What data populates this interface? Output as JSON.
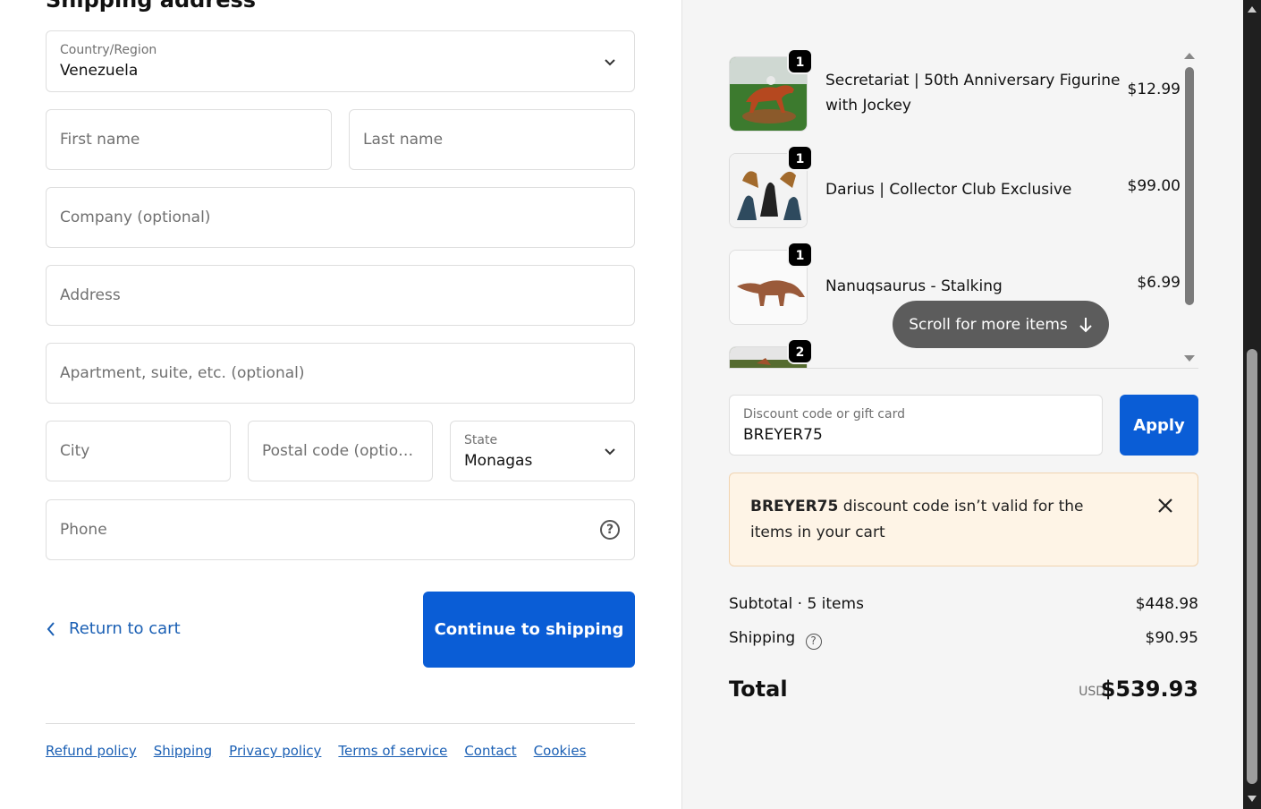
{
  "form": {
    "section_title": "Shipping address",
    "country": {
      "label": "Country/Region",
      "value": "Venezuela"
    },
    "first_name": {
      "placeholder": "First name"
    },
    "last_name": {
      "placeholder": "Last name"
    },
    "company": {
      "placeholder": "Company (optional)"
    },
    "address": {
      "placeholder": "Address"
    },
    "apartment": {
      "placeholder": "Apartment, suite, etc. (optional)"
    },
    "city": {
      "placeholder": "City"
    },
    "postal": {
      "placeholder": "Postal code (option..."
    },
    "state": {
      "label": "State",
      "value": "Monagas"
    },
    "phone": {
      "placeholder": "Phone",
      "help_icon": "?"
    },
    "return_label": "Return to cart",
    "continue_label": "Continue to shipping"
  },
  "footer": {
    "links": [
      "Refund policy",
      "Shipping",
      "Privacy policy",
      "Terms of service",
      "Contact",
      "Cookies"
    ]
  },
  "cart": {
    "items": [
      {
        "qty": "1",
        "name": "Secretariat | 50th Anniversary Figurine with Jockey",
        "price": "$12.99"
      },
      {
        "qty": "1",
        "name": "Darius | Collector Club Exclusive",
        "price": "$99.00"
      },
      {
        "qty": "1",
        "name": "Nanuqsaurus - Stalking",
        "price": "$6.99"
      },
      {
        "qty": "2",
        "name": "",
        "price": ""
      }
    ],
    "scroll_hint": "Scroll for more items"
  },
  "discount": {
    "label": "Discount code or gift card",
    "value": "BREYER75",
    "apply_label": "Apply",
    "error_code": "BREYER75",
    "error_message": " discount code isn’t valid for the items in your cart"
  },
  "summary": {
    "subtotal_label": "Subtotal · 5 items",
    "subtotal_value": "$448.98",
    "shipping_label": "Shipping",
    "shipping_value": "$90.95",
    "total_label": "Total",
    "currency": "USD",
    "total_value": "$539.93"
  },
  "colors": {
    "accent": "#0a5dd6",
    "link": "#1a5fb4",
    "error_bg": "#fef4e6"
  }
}
